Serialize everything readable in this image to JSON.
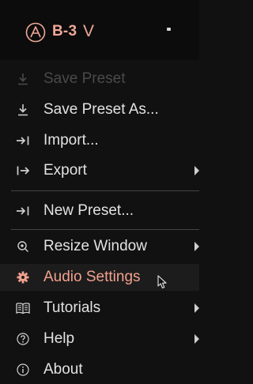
{
  "header": {
    "product_name": "B-3",
    "product_version": "V",
    "accent_color": "#f0a898"
  },
  "menu": {
    "items": [
      {
        "label": "Save Preset",
        "icon": "download-icon",
        "disabled": true,
        "submenu": false
      },
      {
        "label": "Save Preset As...",
        "icon": "download-icon",
        "disabled": false,
        "submenu": false
      },
      {
        "label": "Import...",
        "icon": "import-icon",
        "disabled": false,
        "submenu": false
      },
      {
        "label": "Export",
        "icon": "export-icon",
        "disabled": false,
        "submenu": true
      },
      {
        "label": "New Preset...",
        "icon": "new-preset-icon",
        "disabled": false,
        "submenu": false
      },
      {
        "label": "Resize Window",
        "icon": "zoom-icon",
        "disabled": false,
        "submenu": true
      },
      {
        "label": "Audio Settings",
        "icon": "gear-icon",
        "disabled": false,
        "submenu": false,
        "selected": true
      },
      {
        "label": "Tutorials",
        "icon": "book-icon",
        "disabled": false,
        "submenu": true
      },
      {
        "label": "Help",
        "icon": "help-icon",
        "disabled": false,
        "submenu": true
      },
      {
        "label": "About",
        "icon": "info-icon",
        "disabled": false,
        "submenu": false
      }
    ]
  }
}
